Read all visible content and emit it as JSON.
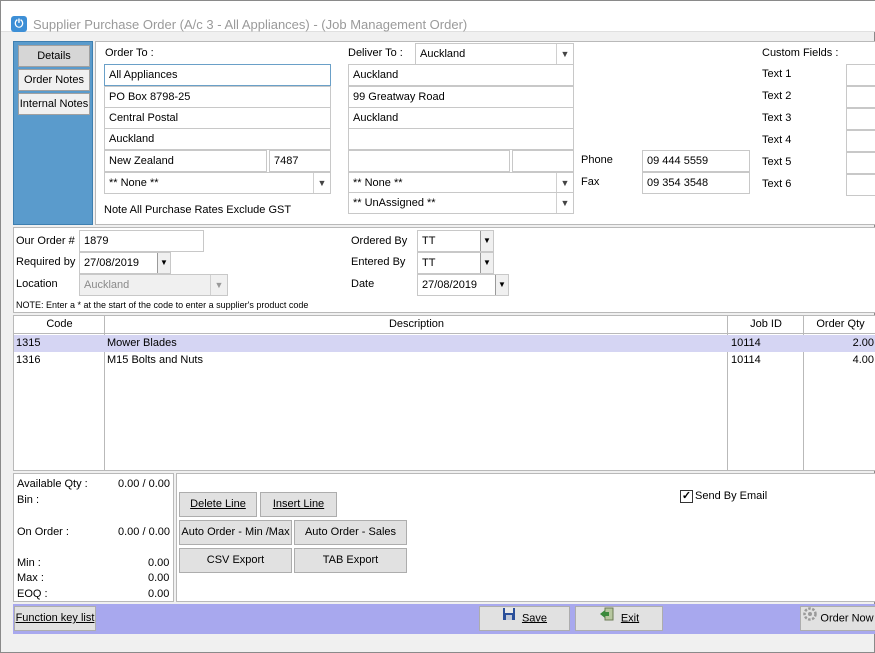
{
  "window": {
    "title": "Supplier Purchase Order (A/c 3 - All Appliances) - (Job Management Order)"
  },
  "tabs": [
    "Details",
    "Order Notes",
    "Internal Notes"
  ],
  "order_to": {
    "label": "Order To  :",
    "lines": [
      "All Appliances",
      "PO Box 8798-25",
      "Central Postal",
      "Auckland"
    ],
    "country": "New Zealand",
    "postcode": "7487",
    "select": "** None **",
    "note": "Note All Purchase Rates Exclude GST"
  },
  "deliver_to": {
    "label": "Deliver To :",
    "location": "Auckland",
    "lines": [
      "Auckland",
      "99 Greatway Road",
      "Auckland",
      ""
    ],
    "select1": "** None **",
    "select2": "** UnAssigned **"
  },
  "contact": {
    "phone_label": "Phone",
    "phone": "09 444 5559",
    "fax_label": "Fax",
    "fax": "09 354 3548"
  },
  "custom_fields": {
    "label": "Custom Fields  :",
    "items": [
      "Text 1",
      "Text 2",
      "Text 3",
      "Text 4",
      "Text 5",
      "Text 6"
    ]
  },
  "order_info": {
    "our_order_label": "Our Order #",
    "our_order": "1879",
    "required_label": "Required by",
    "required": "27/08/2019",
    "location_label": "Location",
    "location": "Auckland",
    "ordered_by_label": "Ordered By",
    "ordered_by": "TT",
    "entered_by_label": "Entered By",
    "entered_by": "TT",
    "date_label": "Date",
    "date": "27/08/2019",
    "note": "NOTE: Enter a * at the start of the code to enter a supplier's product code"
  },
  "grid": {
    "headers": [
      "Code",
      "Description",
      "Job ID",
      "Order Qty"
    ],
    "rows": [
      {
        "code": "1315",
        "description": "Mower Blades",
        "job_id": "10114",
        "qty": "2.00"
      },
      {
        "code": "1316",
        "description": "M15 Bolts and Nuts",
        "job_id": "10114",
        "qty": "4.00"
      }
    ]
  },
  "stock": {
    "available_label": "Available Qty :",
    "available": "0.00 / 0.00",
    "bin_label": "Bin :",
    "on_order_label": "On Order :",
    "on_order": "0.00 / 0.00",
    "min_label": "Min :",
    "min": "0.00",
    "max_label": "Max :",
    "max": "0.00",
    "eoq_label": "EOQ :",
    "eoq": "0.00"
  },
  "actions": {
    "delete_line": "Delete Line",
    "insert_line": "Insert Line",
    "auto_min_max": "Auto Order - Min /Max",
    "auto_sales": "Auto Order - Sales",
    "csv_export": "CSV Export",
    "tab_export": "TAB Export",
    "send_by_email": "Send By Email",
    "send_by_email_checked": true
  },
  "footer": {
    "function_key_list": "Function key list",
    "save": "Save",
    "exit": "Exit",
    "order_now": "Order Now"
  }
}
